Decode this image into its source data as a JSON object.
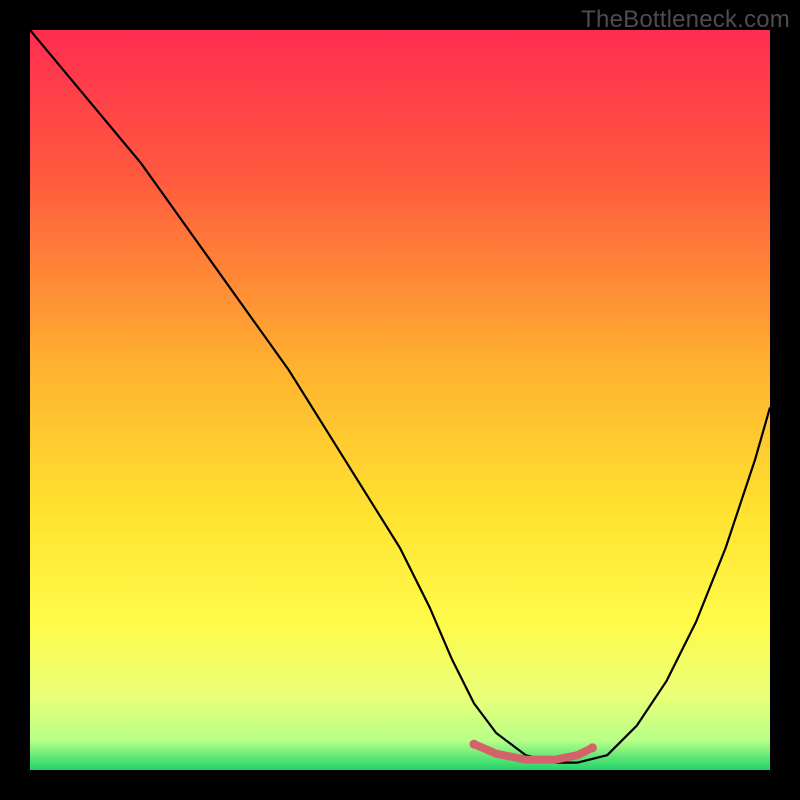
{
  "watermark": "TheBottleneck.com",
  "chart_data": {
    "type": "line",
    "title": "",
    "xlabel": "",
    "ylabel": "",
    "xlim": [
      0,
      100
    ],
    "ylim": [
      0,
      100
    ],
    "grid": false,
    "legend": false,
    "background_gradient": {
      "stops": [
        {
          "offset": 0.0,
          "color": "#ff2d50"
        },
        {
          "offset": 0.2,
          "color": "#ff5a3e"
        },
        {
          "offset": 0.45,
          "color": "#ffb030"
        },
        {
          "offset": 0.65,
          "color": "#ffe230"
        },
        {
          "offset": 0.8,
          "color": "#fffb4a"
        },
        {
          "offset": 0.9,
          "color": "#eaff78"
        },
        {
          "offset": 0.96,
          "color": "#b7ff88"
        },
        {
          "offset": 1.0,
          "color": "#21d36a"
        }
      ]
    },
    "series": [
      {
        "name": "bottleneck-curve",
        "color": "#000000",
        "width": 2.2,
        "x": [
          0,
          5,
          10,
          15,
          20,
          25,
          30,
          35,
          40,
          45,
          50,
          54,
          57,
          60,
          63,
          67,
          71,
          74,
          78,
          82,
          86,
          90,
          94,
          98,
          100
        ],
        "y": [
          100,
          94,
          88,
          82,
          75,
          68,
          61,
          54,
          46,
          38,
          30,
          22,
          15,
          9,
          5,
          2,
          1,
          1,
          2,
          6,
          12,
          20,
          30,
          42,
          49
        ]
      }
    ],
    "highlight_segment": {
      "color": "#d4626a",
      "width": 8,
      "cap": "round",
      "x": [
        60,
        63,
        67,
        71,
        74,
        76
      ],
      "y": [
        3.5,
        2.2,
        1.4,
        1.4,
        2.0,
        3
      ]
    },
    "highlight_points": [
      {
        "x": 60,
        "y": 3.5,
        "r": 4.5,
        "color": "#d4626a"
      },
      {
        "x": 76,
        "y": 3.0,
        "r": 4.5,
        "color": "#d4626a"
      }
    ]
  }
}
